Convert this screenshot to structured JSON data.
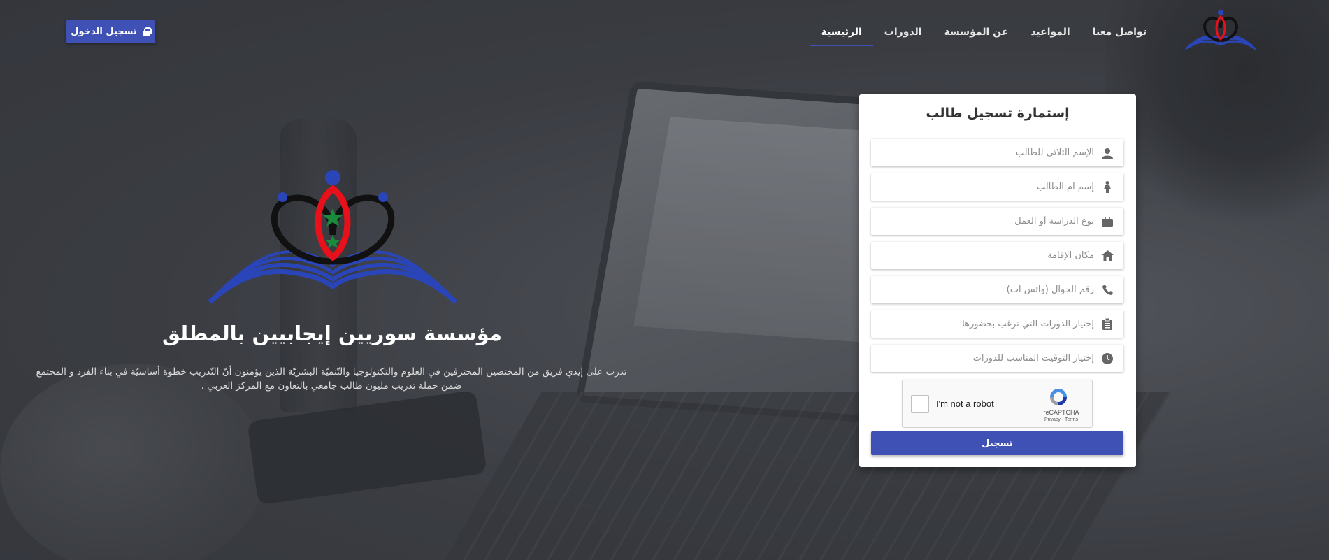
{
  "header": {
    "login_label": "تسجيل الدخول",
    "nav": [
      {
        "label": "الرئيسية",
        "active": true
      },
      {
        "label": "الدورات",
        "active": false
      },
      {
        "label": "عن المؤسسة",
        "active": false
      },
      {
        "label": "المواعيد",
        "active": false
      },
      {
        "label": "تواصل معنا",
        "active": false
      }
    ],
    "logo_icon": "lotus-book-logo"
  },
  "hero": {
    "title": "مؤسسة سوريين إيجابيين بالمطلق",
    "description": "تدرب على إيدي فريق من المختصين المحترفين في العلوم والتكنولوجيا والتّنميّة البشريّة الذين يؤمنون أنّ التّدريب خطوة أساسيّة في بناء الفرد و المجتمع ضمن حملة تدريب مليون طالب جامعي بالتعاون مع المركز العربي ."
  },
  "form": {
    "title": "إستمارة تسجيل طالب",
    "fields": [
      {
        "placeholder": "الإسم الثلاثي للطالب",
        "value": "",
        "icon": "user-icon"
      },
      {
        "placeholder": "إسم أم الطالب",
        "value": "",
        "icon": "female-icon"
      },
      {
        "placeholder": "نوع الدراسة أو العمل",
        "value": "",
        "icon": "briefcase-icon"
      },
      {
        "placeholder": "مكان الإقامة",
        "value": "",
        "icon": "home-icon"
      },
      {
        "placeholder": "رقم الجوال (واتس أب)",
        "value": "",
        "icon": "phone-icon"
      },
      {
        "placeholder": "إختيار الدورات التي ترغب بحضورها",
        "value": "",
        "icon": "clipboard-icon"
      },
      {
        "placeholder": "إختيار التوقيت المناسب للدورات",
        "value": "",
        "icon": "clock-icon"
      }
    ],
    "captcha": {
      "label": "I'm not a robot",
      "brand": "reCAPTCHA",
      "links": "Privacy - Terms"
    },
    "submit_label": "تسجيل"
  },
  "colors": {
    "accent": "#3f51b5",
    "logo_red": "#e8101a",
    "logo_green": "#1a8a3c",
    "logo_blue": "#2a45b8"
  }
}
